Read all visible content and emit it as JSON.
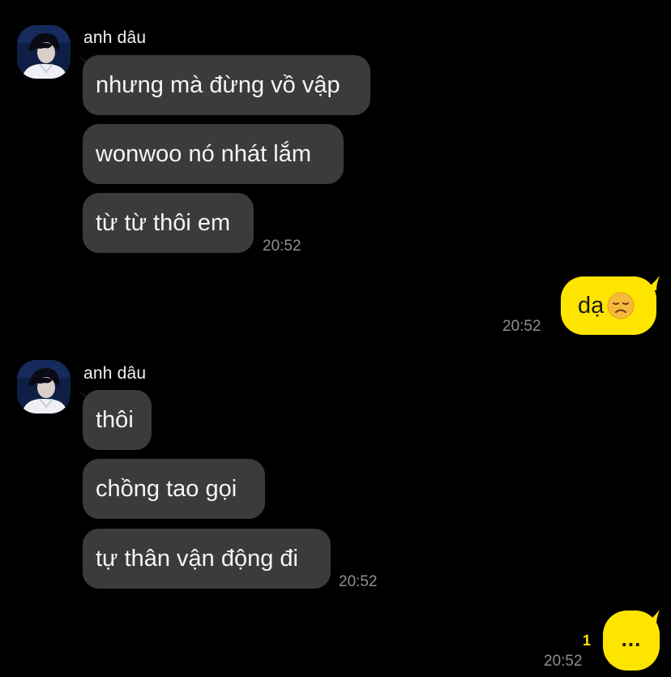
{
  "colors": {
    "background": "#000000",
    "incoming_bubble": "#3b3b3d",
    "outgoing_bubble": "#fee500",
    "timestamp": "#8e8e93",
    "unread": "#fee500"
  },
  "groups": [
    {
      "sender": "anh dâu",
      "messages": [
        "nhưng mà đừng vồ vập",
        "wonwoo nó nhát lắm",
        "từ từ thôi em"
      ],
      "time": "20:52"
    },
    {
      "outgoing": true,
      "text": "dạ",
      "emoji": "disappointed-face-icon",
      "time": "20:52"
    },
    {
      "sender": "anh dâu",
      "messages": [
        "thôi",
        "chồng tao gọi",
        "tự thân vận động đi"
      ],
      "time": "20:52"
    },
    {
      "outgoing": true,
      "text": "...",
      "unread_count": "1",
      "time": "20:52"
    }
  ]
}
